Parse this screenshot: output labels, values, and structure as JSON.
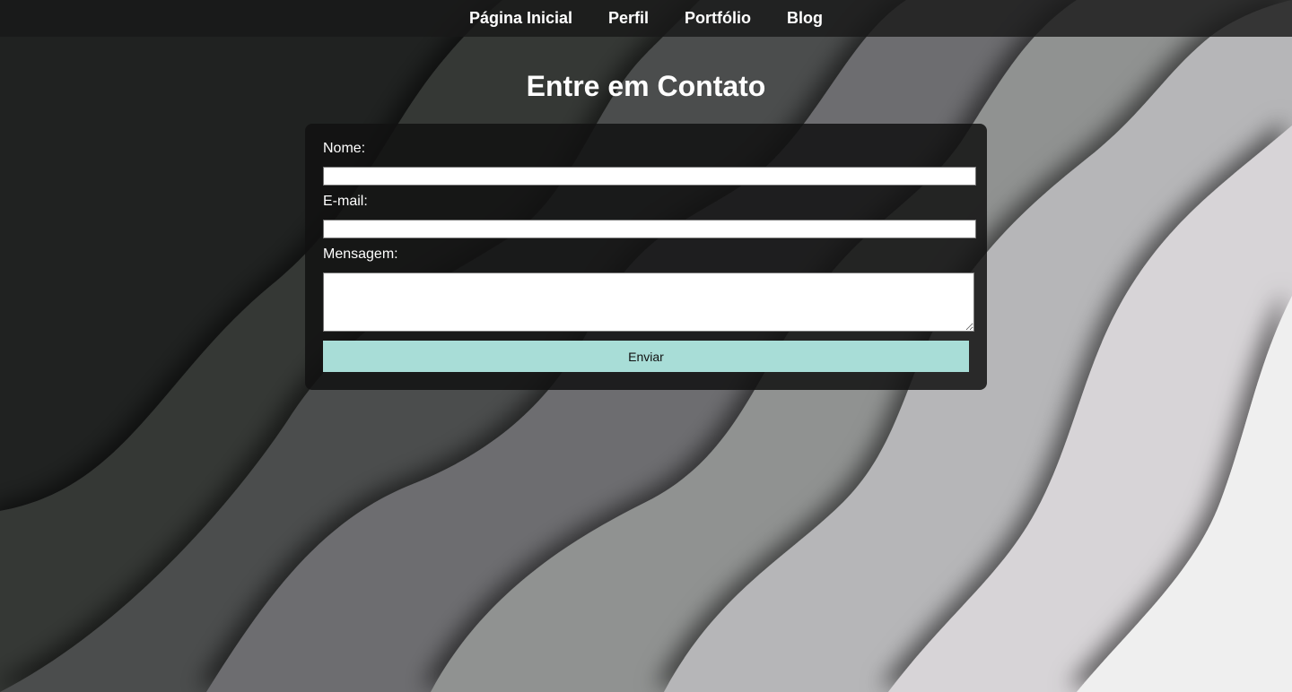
{
  "nav": {
    "items": [
      {
        "label": "Página Inicial"
      },
      {
        "label": "Perfil"
      },
      {
        "label": "Portfólio"
      },
      {
        "label": "Blog"
      }
    ]
  },
  "page": {
    "title": "Entre em Contato"
  },
  "form": {
    "name_label": "Nome:",
    "name_value": "",
    "email_label": "E-mail:",
    "email_value": "",
    "message_label": "Mensagem:",
    "message_value": "",
    "submit_label": "Enviar"
  },
  "colors": {
    "accent_button": "#a8ddd7",
    "panel": "#111111",
    "nav_bar": "#181818"
  }
}
